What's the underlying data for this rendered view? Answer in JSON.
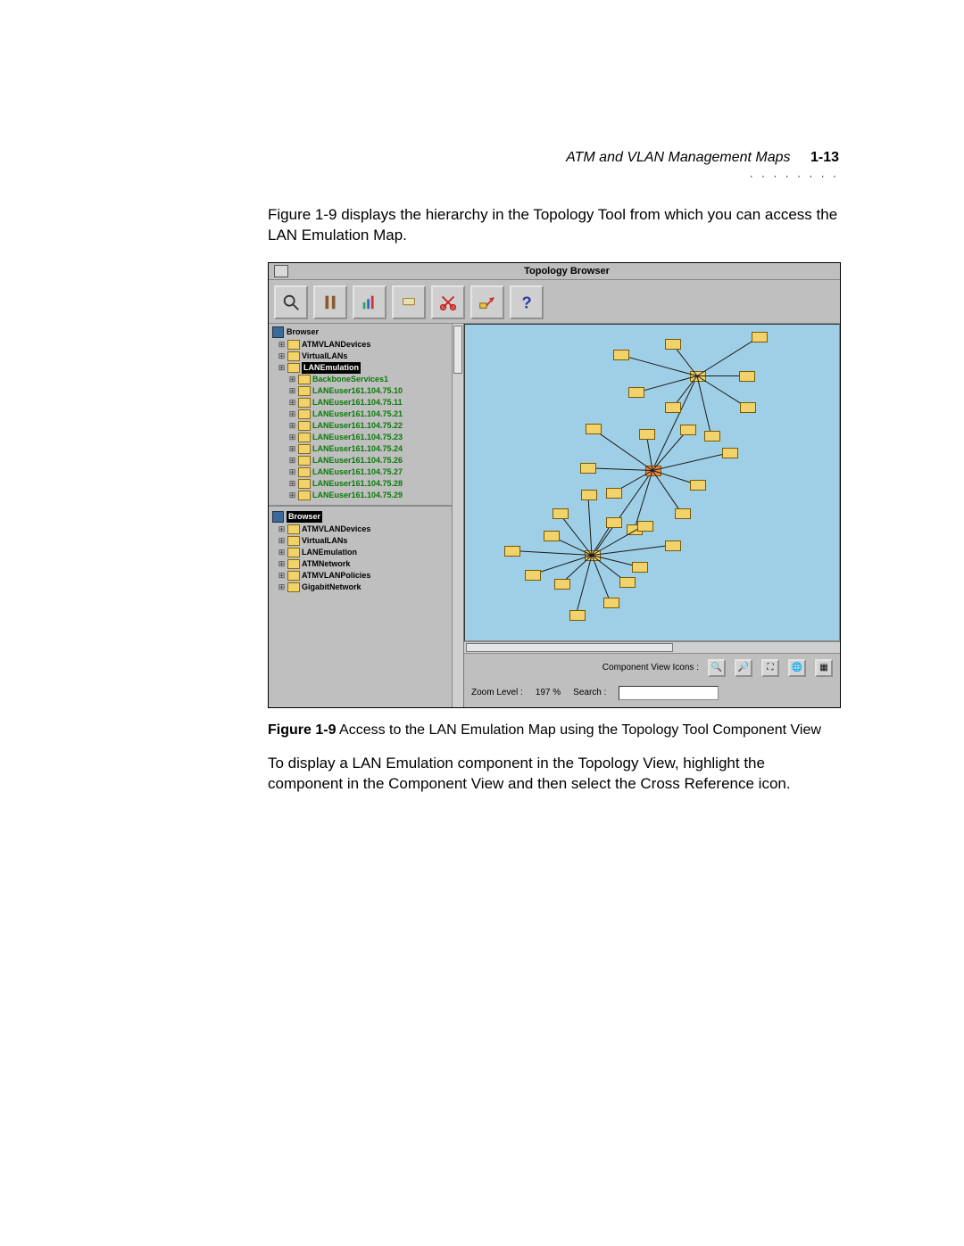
{
  "header": {
    "title": "ATM and VLAN Management Maps",
    "page": "1-13"
  },
  "intro": "Figure 1-9 displays the hierarchy in the Topology Tool from which you can access the LAN Emulation Map.",
  "window": {
    "title": "Topology Browser",
    "toolbar": {
      "search": "search-icon",
      "bottles": "filter-icon",
      "chart": "chart-icon",
      "tag": "tag-icon",
      "cut": "cut-icon",
      "cross": "cross-reference-icon",
      "help": "help-icon"
    },
    "tree_a": {
      "root": "Browser",
      "items": [
        {
          "label": "ATMVLANDevices",
          "sel": false,
          "green": false
        },
        {
          "label": "VirtualLANs",
          "sel": false,
          "green": false
        },
        {
          "label": "LANEmulation",
          "sel": true,
          "green": false
        },
        {
          "label": "BackboneServices1",
          "sel": false,
          "green": true,
          "indent": 1
        },
        {
          "label": "LANEuser161.104.75.10",
          "sel": false,
          "green": true,
          "indent": 1
        },
        {
          "label": "LANEuser161.104.75.11",
          "sel": false,
          "green": true,
          "indent": 1
        },
        {
          "label": "LANEuser161.104.75.21",
          "sel": false,
          "green": true,
          "indent": 1
        },
        {
          "label": "LANEuser161.104.75.22",
          "sel": false,
          "green": true,
          "indent": 1
        },
        {
          "label": "LANEuser161.104.75.23",
          "sel": false,
          "green": true,
          "indent": 1
        },
        {
          "label": "LANEuser161.104.75.24",
          "sel": false,
          "green": true,
          "indent": 1
        },
        {
          "label": "LANEuser161.104.75.26",
          "sel": false,
          "green": true,
          "indent": 1
        },
        {
          "label": "LANEuser161.104.75.27",
          "sel": false,
          "green": true,
          "indent": 1
        },
        {
          "label": "LANEuser161.104.75.28",
          "sel": false,
          "green": true,
          "indent": 1
        },
        {
          "label": "LANEuser161.104.75.29",
          "sel": false,
          "green": true,
          "indent": 1
        }
      ]
    },
    "tree_b": {
      "root": "Browser",
      "items": [
        {
          "label": "ATMVLANDevices"
        },
        {
          "label": "VirtualLANs"
        },
        {
          "label": "LANEmulation"
        },
        {
          "label": "ATMNetwork"
        },
        {
          "label": "ATMVLANPolicies"
        },
        {
          "label": "GigabitNetwork"
        }
      ]
    },
    "status": {
      "component_label": "Component View Icons :",
      "zoom_label": "Zoom Level :",
      "zoom_value": "197 %",
      "search_label": "Search :"
    }
  },
  "caption": {
    "strong": "Figure 1-9",
    "rest": "   Access to the LAN Emulation Map using the Topology Tool Component View"
  },
  "outro": "To display a LAN Emulation component in the Topology View, highlight the component in the Component View and then select the Cross Reference icon."
}
